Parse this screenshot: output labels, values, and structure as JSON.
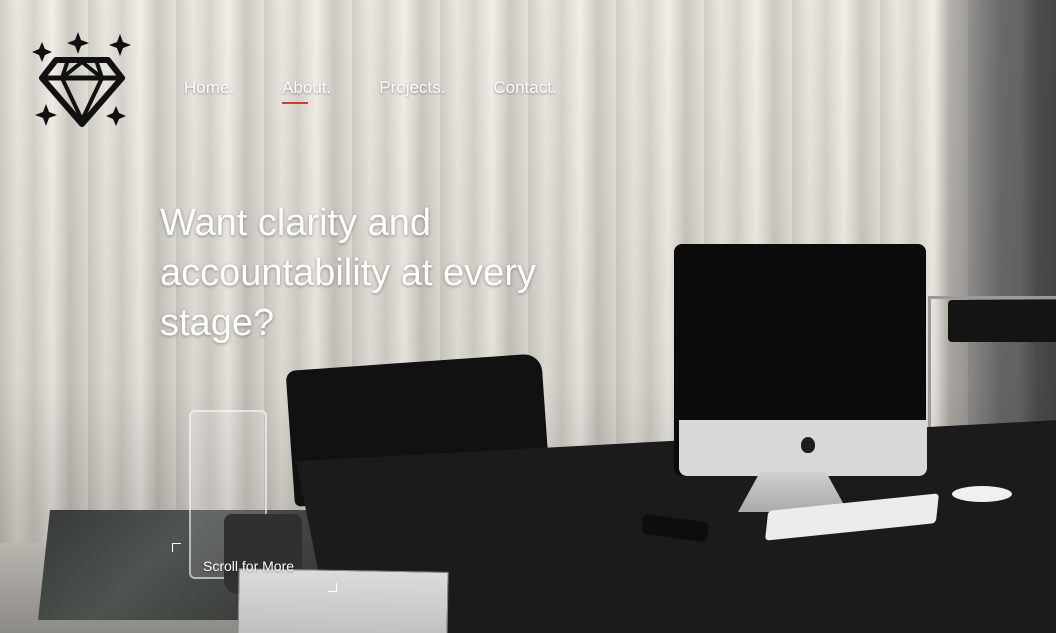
{
  "nav": {
    "items": [
      {
        "label": "Home."
      },
      {
        "label": "About."
      },
      {
        "label": "Projects."
      },
      {
        "label": "Contact."
      }
    ],
    "active_index": 1,
    "active_color": "#d23a2e"
  },
  "logo": {
    "icon": "diamond-sparkle-icon"
  },
  "hero": {
    "headline_line1": "Want clarity and",
    "headline_line2": "accountability at every",
    "headline_line3": "stage?"
  },
  "scroll": {
    "label": "Scroll for More"
  }
}
